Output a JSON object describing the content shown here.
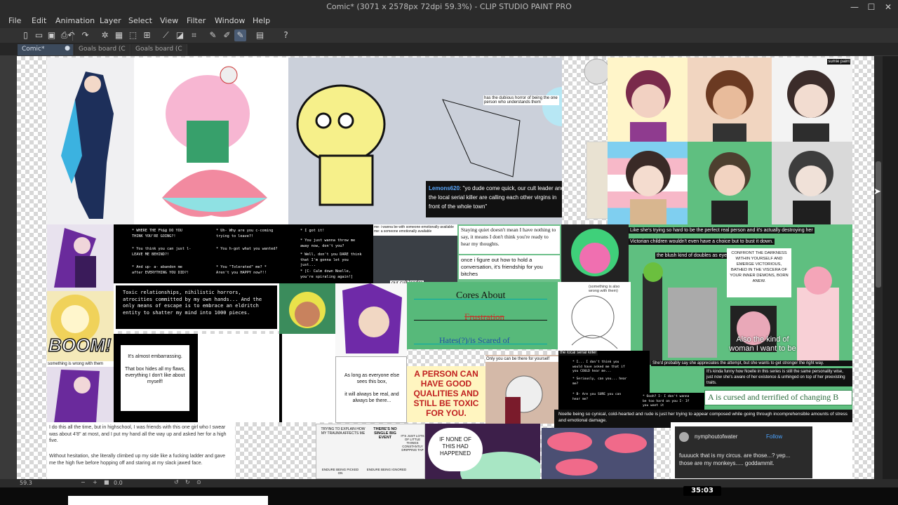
{
  "window": {
    "title": "Comic* (3071 x 2578px 72dpi 59.3%)  - CLIP STUDIO PAINT PRO",
    "min_glyph": "—",
    "max_glyph": "☐",
    "close_glyph": "✕"
  },
  "menu": [
    "File",
    "Edit",
    "Animation",
    "Layer",
    "Select",
    "View",
    "Filter",
    "Window",
    "Help"
  ],
  "tabs": [
    {
      "label": "Comic*",
      "active": true
    },
    {
      "label": "Goals board (C",
      "active": false
    },
    {
      "label": "Goals board (C",
      "active": false
    }
  ],
  "icons": {
    "new": "new-file-icon",
    "open": "open-folder-icon",
    "save": "save-icon",
    "print": "print-icon",
    "undo": "undo-icon",
    "redo": "redo-icon",
    "help": "help-icon"
  },
  "canvas": {
    "quote_username": "Lemons620",
    "quote_text": ": \"yo dude come quick, our cult leader and the local serial killer are calling each other virgins in front of the whole town\"",
    "dubious_label": "has the dubious horror of being the one person who understands them",
    "dialogue_lines": [
      "* WHERE THE F%$@ DO YOU THINK YOU'RE GOING?!",
      "* You think you can just l- LEAVE ME BEHIND?!",
      "* And up- a- abandon me after EVERYTHING YOU DID?!",
      "* Uh- Why are you c-coming trying to leave?!",
      "* You h-got what you wanted?",
      "* You \"Tolerated\" me? * Aren't you HAPPY now?!!",
      "* I got it!",
      "* You just wanna throw me away now, don't you?",
      "* Well, don't you DARE think that I'm gonna let you just...",
      "* [C- Calm down Noelle, you're spiraling again!]"
    ],
    "toxic_text": "Toxic relationships, nihilistic horrors, atrocities committed by my own hands... And the only means of escape is to embrace an eldritch entity to shatter my mind into 1000 pieces.",
    "boom": "BOOM!",
    "something_wrong": "something is wrong with them",
    "almost_embarrassing": "It's almost embarrassing.\n\nThat box hides all my flaws, everything I don't like about myself!",
    "long_as": "As long as everyone else sees this box,\n\nit will always be real, and always be there...",
    "cult_leader_tag": "our cult leader",
    "emo_caption": "me: i wanna be with someone emotionally available\nme: a someone emotionally available",
    "staying_quiet": "Staying quiet doesn't mean I have nothing to say, it means I don't think you're ready to hear my thoughts.",
    "figure_out": "once i figure out how to hold a conversation, it's friendship for you bitches",
    "cores_about": "Cores About",
    "frustration": "Frustration",
    "hates": "Hates(?)/is Scared of",
    "toxic_bold": "A PERSON CAN HAVE GOOD QUALITIES AND STILL BE TOXIC FOR YOU.",
    "only_you": "Only you can be there for yourself",
    "local_killer": "the local serial killer",
    "dialogue2": [
      "* I... I don't think you would have asked me that if you COULD hear me...",
      "* Seriously, can you... hear me?",
      "* B- Are you SURE you can hear me?",
      "* Oooh? I- I don't wanna be too hard on you I- If you want it"
    ],
    "something_also": "(something is also wrong with them)",
    "perfect_person": "Like she's trying so hard to be the perfect real person and it's actually destroying her",
    "victorian": "Victorian children wouldn't even have a choice but to bust it down.",
    "blush": "the blush kind of doubles as eyebags.",
    "confront": "CONFRONT THE DARKNESS WITHIN YOURSELF AND EMERGE VICTORIOUS, BATHED IN THE VISCERA OF YOUR INNER DEMONS, BORN ANEW.",
    "kind_of_woman": "Also the kind of woman I want to be",
    "appreciate": "She'd probably say she appreciates the attempt, but she wants to get stronger the right way.",
    "kinda_funny": "It's kinda funny how Noelle in this series is still the same personality wise, just now she's aware of her existence & unhinged on top of her preexisting traits.",
    "cursed": "A is cursed and terrified of changing B",
    "noelle_cynical": "Noelle being so cynical, cold-hearted and rude is just her trying to appear composed while going through incomprehensible amounts of stress and emotional damage.",
    "highschool": "I do this all the time, but in highschool, I was friends with this one girl who I swear was about 4'8\" at most, and I put my hand all the way up and asked her for a high five.",
    "hesitation": "Without hesitation, she literally climbed up my side like a fucking ladder and gave me the high five before hopping off and staring at my slack jawed face.",
    "trying_explain": "TRYING TO EXPLAIN HOW MY TRAUMA AFFECTS ME",
    "big_event": "THERE'S NO SINGLE BIG EVENT",
    "little_things": "IT'S JUST LOTS OF LITTLE THINGS CONSTANTLY DRIPPING TAP",
    "ignore_1": "ENDURE BEING PICKED ON",
    "ignore_2": "ENDURE BEING IGNORED",
    "if_none": "IF NONE OF THIS HAD HAPPENED",
    "tweet_user": "nymphoutofwater",
    "tweet_follow": "Follow",
    "tweet_text": "fuuuuck that is my circus. are those...? yep... those are my monkeys..... goddammit.",
    "sumie": "sumie paint"
  },
  "status": {
    "zoom": "59.3",
    "rotation": "0.0",
    "time": "35:03"
  }
}
